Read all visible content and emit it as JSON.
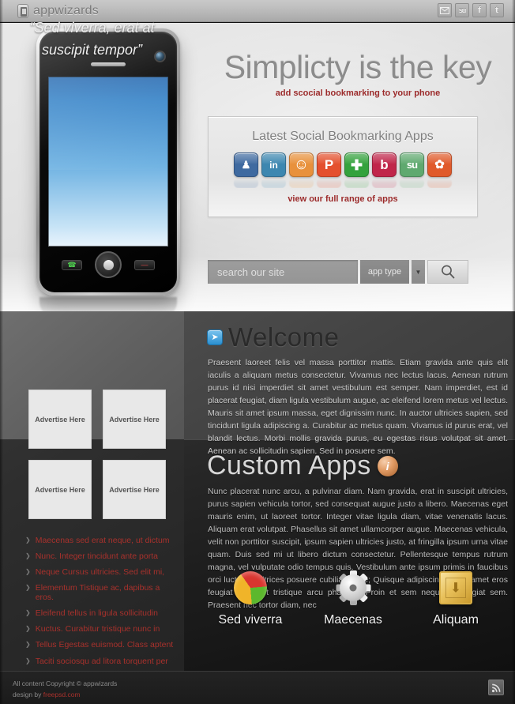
{
  "topbar": {
    "logo_text": "appwizards",
    "logo_icon": "phone-icon",
    "social": [
      {
        "name": "mail-icon",
        "glyph": "✉",
        "title": "Email"
      },
      {
        "name": "stumbleupon-icon",
        "glyph": "su",
        "title": "StumbleUpon"
      },
      {
        "name": "facebook-icon",
        "glyph": "f",
        "title": "Facebook"
      },
      {
        "name": "twitter-icon",
        "glyph": "t",
        "title": "Twitter"
      }
    ]
  },
  "hero": {
    "title": "Simplicty is the key",
    "subtitle": "add scocial bookmarking to your phone",
    "phone": {
      "call_button": "☎",
      "end_button": "—",
      "home_button": "home-button"
    }
  },
  "apps_panel": {
    "title": "Latest Social Bookmarking Apps",
    "link": "view our full range of apps",
    "icons": [
      {
        "name": "myspace-icon",
        "glyph": "♟",
        "color": "#3f6aa0"
      },
      {
        "name": "linkedin-icon",
        "glyph": "in",
        "color": "#3d87b0"
      },
      {
        "name": "smiley-icon",
        "glyph": "☺",
        "color": "#e8913c"
      },
      {
        "name": "plurk-icon",
        "glyph": "P",
        "color": "#e4502e"
      },
      {
        "name": "plus-icon",
        "glyph": "✚",
        "color": "#34a23d"
      },
      {
        "name": "bebo-icon",
        "glyph": "b",
        "color": "#c0264a"
      },
      {
        "name": "stumbleupon-icon",
        "glyph": "su",
        "color": "#5fa96f"
      },
      {
        "name": "diigo-icon",
        "glyph": "✿",
        "color": "#e05a2b"
      }
    ]
  },
  "search": {
    "placeholder": "search our site",
    "value": "",
    "app_type_label": "app type",
    "dropdown_arrow": "▼",
    "button_icon": "search-icon"
  },
  "sidebar": {
    "quote": "“Sed viverra, erat at suscipit tempor”",
    "ads": [
      {
        "label": "Advertise Here"
      },
      {
        "label": "Advertise Here"
      },
      {
        "label": "Advertise Here"
      },
      {
        "label": "Advertise Here"
      }
    ],
    "bullet": "❯",
    "links": [
      "Maecenas sed erat neque, ut dictum",
      "Nunc. Integer tincidunt ante porta",
      "Neque Cursus ultricies. Sed elit mi,",
      "Elementum Tistique ac, dapibus a eros.",
      "Eleifend tellus in ligula sollicitudin",
      "Kuctus. Curabitur tristique nunc in",
      "Tellus Egestas euismod. Class aptent",
      "Taciti sociosqu ad litora torquent per"
    ]
  },
  "welcome": {
    "icon": "arrow-right-icon",
    "icon_glyph": "➤",
    "title": "Welcome",
    "body": "Praesent laoreet felis vel massa porttitor mattis. Etiam gravida ante quis elit iaculis a aliquam metus consectetur. Vivamus nec lectus lacus. Aenean rutrum purus id nisi imperdiet sit amet vestibulum est semper. Nam imperdiet, est id placerat feugiat, diam ligula vestibulum augue, ac eleifend lorem metus vel lectus. Mauris sit amet ipsum massa, eget dignissim nunc. In auctor ultricies sapien, sed tincidunt ligula adipiscing a. Curabitur ac metus quam. Vivamus id purus erat, vel blandit lectus. Morbi mollis gravida purus, eu egestas risus volutpat sit amet. Aenean ac sollicitudin sapien. Sed in posuere sem."
  },
  "custom_apps": {
    "title": "Custom Apps",
    "icon": "info-icon",
    "icon_glyph": "i",
    "body": "Nunc placerat nunc arcu, a pulvinar diam. Nam gravida, erat in suscipit ultricies, purus sapien vehicula tortor, sed consequat augue justo a libero. Maecenas eget mauris enim, ut laoreet tortor. Integer vitae ligula diam, vitae venenatis lacus. Aliquam erat volutpat. Phasellus sit amet ullamcorper augue. Maecenas vehicula, velit non porttitor suscipit, ipsum sapien ultricies justo, at fringilla ipsum urna vitae quam. Duis sed mi ut libero dictum consectetur. Pellentesque tempus rutrum magna, vel vulputate odio tempus quis. Vestibulum ante ipsum primis in faucibus orci luctus et ultrices posuere cubilia Curae; Quisque adipiscing elit sit amet eros feugiat sit amet tristique arcu pharetra. Proin et sem neque, a feugiat sem. Praesent nec tortor diam, nec",
    "features": [
      {
        "label": "Sed viverra",
        "icon": "pie-chart-icon"
      },
      {
        "label": "Maecenas",
        "icon": "gear-icon"
      },
      {
        "label": "Aliquam",
        "icon": "package-box-icon"
      }
    ]
  },
  "footer": {
    "copyright": "All content Copyright © appwizards",
    "design_prefix": "design by ",
    "design_link": "freepsd.com",
    "rss_icon": "rss-icon"
  },
  "colors": {
    "accent_red": "#9c2b2b",
    "link_red": "#a8312c",
    "hero_grey": "#8c8c8c",
    "dark_bg": "#1d1d1d"
  }
}
